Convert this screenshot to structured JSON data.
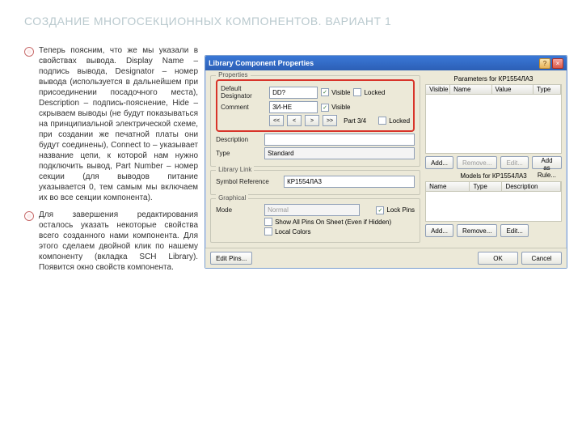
{
  "slide": {
    "title": "СОЗДАНИЕ МНОГОСЕКЦИОННЫХ КОМПОНЕНТОВ. ВАРИАНТ 1",
    "para1": "Теперь поясним, что же мы указали в свойствах вывода. Display Name – подпись вывода, Designator – номер вывода (используется в дальнейшем при присоединении посадочного места), Description – подпись-пояснение, Hide – скрываем выводы (не будут показываться на принципиальной электрической схеме, при создании же печатной платы они будут соединены), Connect to – указывает название цепи, к которой нам нужно подключить вывод, Part Number – номер секции (для выводов питание указывается 0, тем самым мы включаем их во все секции компонента).",
    "para2": "Для завершения редактирования осталось указать некоторые свойства всего созданного нами компонента. Для этого сделаем двойной клик по нашему компоненту (вкладка SCH Library). Появится окно свойств компонента."
  },
  "window": {
    "title": "Library Component Properties",
    "groups": {
      "properties": "Properties",
      "libraryLink": "Library Link",
      "graphical": "Graphical",
      "parameters_for": "Parameters for КР1554ЛА3",
      "models_for": "Models for КР1554ЛА3"
    },
    "labels": {
      "defaultDesignator": "Default Designator",
      "comment": "Comment",
      "description": "Description",
      "type": "Type",
      "symbolRef": "Symbol Reference",
      "mode": "Mode"
    },
    "values": {
      "designator": "DD?",
      "comment": "3И-НЕ",
      "part": "Part 3/4",
      "type": "Standard",
      "symbolRef": "КР1554ЛА3",
      "mode": "Normal"
    },
    "checks": {
      "visible": "Visible",
      "locked": "Locked",
      "lockPins": "Lock Pins",
      "showAllPins": "Show All Pins On Sheet (Even if Hidden)",
      "localColors": "Local Colors"
    },
    "nav": {
      "first": "<<",
      "prev": "<",
      "next": ">",
      "last": ">>"
    },
    "paramCols": {
      "visible": "Visible",
      "name": "Name",
      "value": "Value",
      "type": "Type"
    },
    "modelCols": {
      "name": "Name",
      "type": "Type",
      "desc": "Description"
    },
    "buttons": {
      "add": "Add...",
      "remove": "Remove...",
      "edit": "Edit...",
      "addAsRule": "Add as Rule...",
      "editPins": "Edit Pins...",
      "ok": "OK",
      "cancel": "Cancel"
    }
  }
}
